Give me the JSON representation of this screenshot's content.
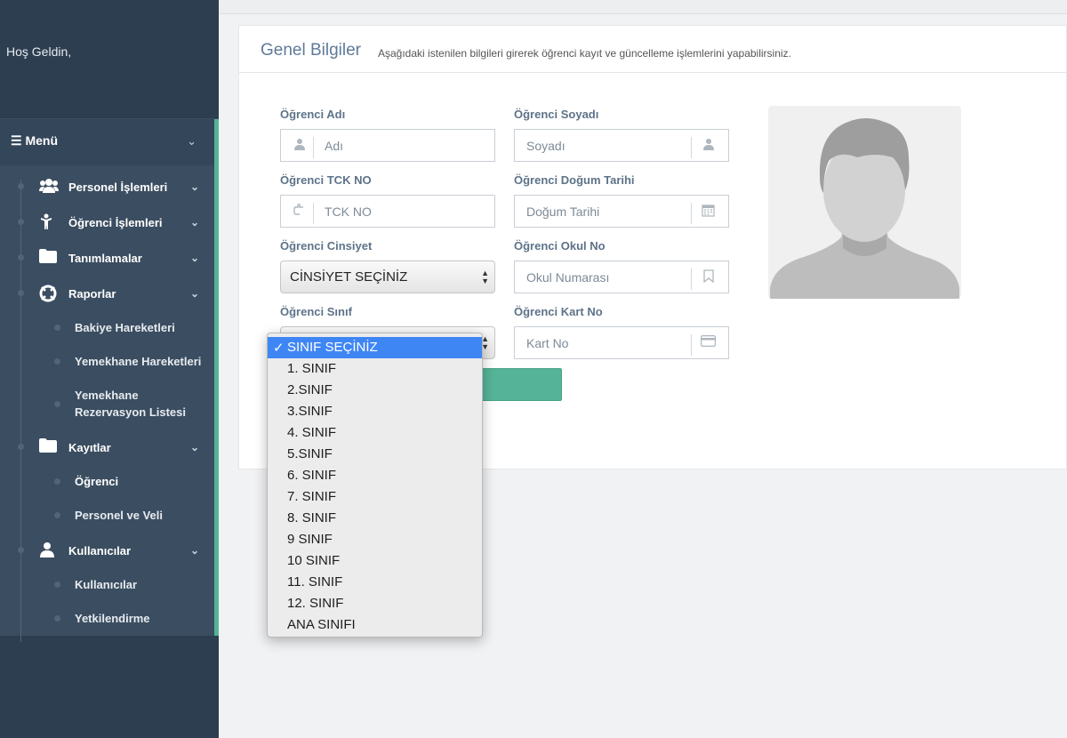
{
  "sidebar": {
    "welcome": "Hoş Geldin,",
    "menu_label": "☰ Menü",
    "items": [
      {
        "label": "Personel İşlemleri",
        "icon": "users-icon"
      },
      {
        "label": "Öğrenci İşlemleri",
        "icon": "person-icon"
      },
      {
        "label": "Tanımlamalar",
        "icon": "folder-icon"
      },
      {
        "label": "Raporlar",
        "icon": "lifebuoy-icon"
      },
      {
        "label": "Kayıtlar",
        "icon": "folder-icon"
      },
      {
        "label": "Kullanıcılar",
        "icon": "user-icon"
      }
    ],
    "raporlar_sub": [
      "Bakiye Hareketleri",
      "Yemekhane Hareketleri",
      "Yemekhane",
      "Rezervasyon Listesi"
    ],
    "kayitlar_sub": [
      "Öğrenci",
      "Personel ve Veli"
    ],
    "kullanicilar_sub": [
      "Kullanıcılar",
      "Yetkilendirme"
    ],
    "colors": {
      "bg": "#2d3e50",
      "accent": "#54b395"
    }
  },
  "card": {
    "title": "Genel Bilgiler",
    "subtitle": "Aşağıdaki istenilen bilgileri girerek öğrenci kayıt ve güncelleme işlemlerini yapabilirsiniz."
  },
  "form": {
    "ad_label": "Öğrenci Adı",
    "ad_placeholder": "Adı",
    "soyad_label": "Öğrenci Soyadı",
    "soyad_placeholder": "Soyadı",
    "tck_label": "Öğrenci TCK NO",
    "tck_placeholder": "TCK NO",
    "dogum_label": "Öğrenci Doğum Tarihi",
    "dogum_placeholder": "Doğum Tarihi",
    "cinsiyet_label": "Öğrenci Cinsiyet",
    "cinsiyet_value": "CİNSİYET SEÇİNİZ",
    "okulno_label": "Öğrenci Okul No",
    "okulno_placeholder": "Okul Numarası",
    "sinif_label": "Öğrenci Sınıf",
    "kart_label": "Öğrenci Kart No",
    "kart_placeholder": "Kart No",
    "save_color": "#55b497"
  },
  "dropdown": {
    "selected_check": "✓",
    "options": [
      "SINIF SEÇİNİZ",
      "1. SINIF",
      "2.SINIF",
      "3.SINIF",
      "4. SINIF",
      "5.SINIF",
      "6. SINIF",
      "7. SINIF",
      "8. SINIF",
      "9 SINIF",
      "10 SINIF",
      "11. SINIF",
      "12. SINIF",
      "ANA SINIFI"
    ],
    "selected_color": "#3f86f5"
  }
}
